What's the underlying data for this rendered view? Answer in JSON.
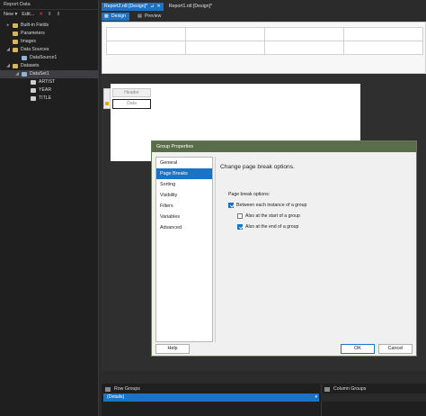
{
  "report_data_panel": {
    "title": "Report Data",
    "toolbar": {
      "new_label": "New ▾",
      "edit_label": "Edit...",
      "delete_icon": "✕",
      "up_icon": "⇧",
      "down_icon": "⇩"
    },
    "tree": {
      "builtin": "Built-in Fields",
      "parameters": "Parameters",
      "images": "Images",
      "data_sources": "Data Sources",
      "datasource1": "DataSource1",
      "datasets": "Datasets",
      "dataset1": "DataSet1",
      "fields": [
        "ARTIST",
        "YEAR",
        "TITLE"
      ]
    }
  },
  "tabs": [
    {
      "label": "Report2.rdl [Design]*",
      "active": true
    },
    {
      "label": "Report1.rdl [Design]*",
      "active": false
    }
  ],
  "view_tabs": {
    "design": "Design",
    "preview": "Preview"
  },
  "tablix": {
    "header": "Header",
    "data": "Data"
  },
  "dialog": {
    "title": "Group Properties",
    "nav": [
      "General",
      "Page Breaks",
      "Sorting",
      "Visibility",
      "Filters",
      "Variables",
      "Advanced"
    ],
    "selected_nav": 1,
    "heading": "Change page break options.",
    "options_label": "Page break options:",
    "options": [
      {
        "label": "Between each instance of a group",
        "checked": true
      },
      {
        "label": "Also at the start of a group",
        "checked": false
      },
      {
        "label": "Also at the end of a group",
        "checked": true
      }
    ],
    "help": "Help",
    "ok": "OK",
    "cancel": "Cancel"
  },
  "groups": {
    "row_groups": "Row Groups",
    "column_groups": "Column Groups",
    "row_group_item": "(Details)"
  }
}
